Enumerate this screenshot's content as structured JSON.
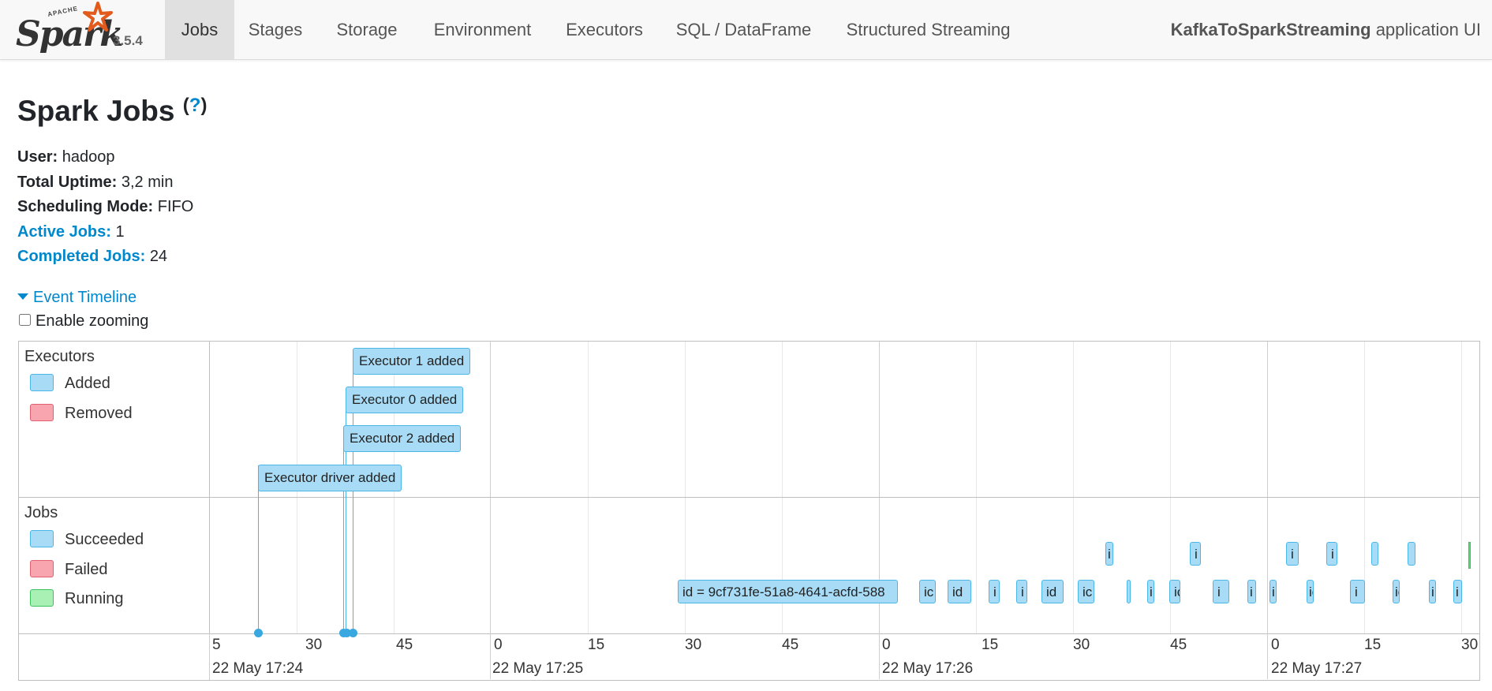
{
  "nav": {
    "apache_label": "APACHE",
    "brand": "Spark",
    "version": "3.5.4",
    "tabs": [
      {
        "label": "Jobs",
        "active": true
      },
      {
        "label": "Stages",
        "active": false
      },
      {
        "label": "Storage",
        "active": false
      },
      {
        "label": "Environment",
        "active": false
      },
      {
        "label": "Executors",
        "active": false
      },
      {
        "label": "SQL / DataFrame",
        "active": false
      },
      {
        "label": "Structured Streaming",
        "active": false
      }
    ],
    "app_name": "KafkaToSparkStreaming",
    "app_suffix": "application UI"
  },
  "page": {
    "title": "Spark Jobs",
    "help": "?"
  },
  "summary": {
    "user_label": "User:",
    "user_value": "hadoop",
    "uptime_label": "Total Uptime:",
    "uptime_value": "3,2 min",
    "mode_label": "Scheduling Mode:",
    "mode_value": "FIFO",
    "active_label": "Active Jobs:",
    "active_value": "1",
    "completed_label": "Completed Jobs:",
    "completed_value": "24"
  },
  "timeline": {
    "toggle_label": "Event Timeline",
    "zoom_label": "Enable zooming",
    "zoom_checked": false,
    "executors_group": {
      "title": "Executors",
      "legend": [
        {
          "label": "Added",
          "color": "#a8dcf6",
          "border": "#4ab6e8"
        },
        {
          "label": "Removed",
          "color": "#f8a5b0",
          "border": "#e06070"
        }
      ],
      "events": [
        {
          "label": "Executor 1 added"
        },
        {
          "label": "Executor 0 added"
        },
        {
          "label": "Executor 2 added"
        },
        {
          "label": "Executor driver added"
        }
      ]
    },
    "jobs_group": {
      "title": "Jobs",
      "legend": [
        {
          "label": "Succeeded",
          "color": "#a8dcf6",
          "border": "#4ab6e8"
        },
        {
          "label": "Failed",
          "color": "#f8a5b0",
          "border": "#e06070"
        },
        {
          "label": "Running",
          "color": "#a8f0b4",
          "border": "#3cc25c"
        }
      ],
      "first_job_label": "id = 9cf731fe-51a8-4641-acfd-588",
      "truncated_labels": [
        "ic",
        "id",
        "i",
        "i",
        "id",
        "ic",
        "i",
        "i",
        "ic",
        "i",
        "i",
        "i",
        "ic",
        "i",
        "ic",
        "i",
        "i",
        "i",
        "i",
        "i",
        "i"
      ]
    },
    "ticks": [
      "5",
      "30",
      "45",
      "0",
      "15",
      "30",
      "45",
      "0",
      "15",
      "30",
      "45",
      "0",
      "15",
      "30"
    ],
    "dates": [
      "22 May 17:24",
      "22 May 17:25",
      "22 May 17:26",
      "22 May 17:27"
    ]
  }
}
